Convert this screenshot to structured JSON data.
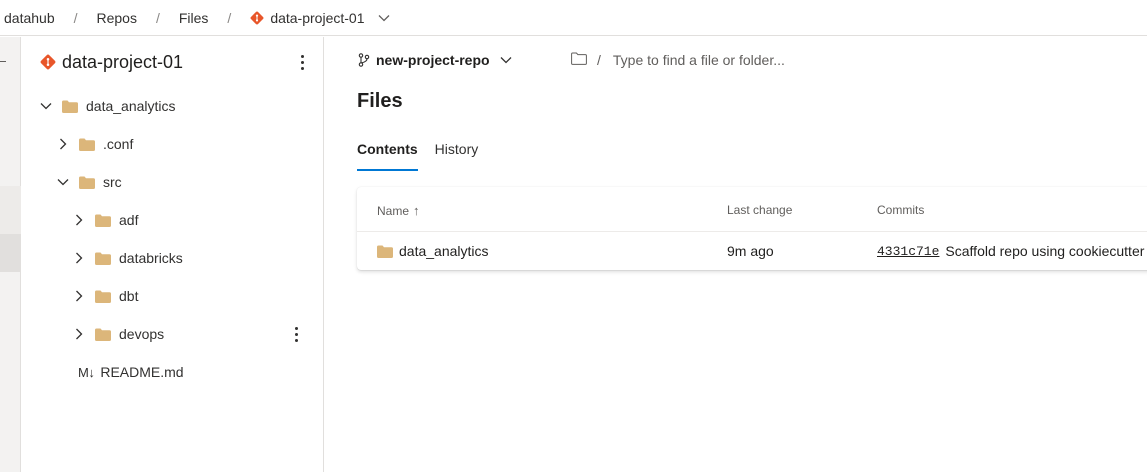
{
  "breadcrumb": {
    "org": "datahub",
    "section": "Repos",
    "page": "Files",
    "repo": "data-project-01",
    "separator": "/"
  },
  "tree": {
    "title": "data-project-01",
    "nodes": [
      {
        "label": "data_analytics",
        "type": "folder",
        "expanded": true
      },
      {
        "label": ".conf",
        "type": "folder",
        "expanded": false
      },
      {
        "label": "src",
        "type": "folder",
        "expanded": true
      },
      {
        "label": "adf",
        "type": "folder",
        "expanded": false
      },
      {
        "label": "databricks",
        "type": "folder",
        "expanded": false
      },
      {
        "label": "dbt",
        "type": "folder",
        "expanded": false
      },
      {
        "label": "devops",
        "type": "folder",
        "expanded": false
      },
      {
        "label": "README.md",
        "type": "markdown"
      }
    ],
    "md_glyph": "M↓"
  },
  "main": {
    "branch": "new-project-repo",
    "path_separator": "/",
    "path_placeholder": "Type to find a file or folder...",
    "title": "Files",
    "tabs": [
      {
        "label": "Contents",
        "active": true
      },
      {
        "label": "History",
        "active": false
      }
    ],
    "table": {
      "columns": {
        "name": "Name",
        "last_change": "Last change",
        "commits": "Commits"
      },
      "sort_indicator": "↑",
      "rows": [
        {
          "name": "data_analytics",
          "last_change": "9m ago",
          "commit_id": "4331c71e",
          "commit_msg": "Scaffold repo using cookiecutter"
        }
      ]
    }
  },
  "colors": {
    "accent": "#0078d4",
    "folder": "#dcb67a",
    "git": "#e8562a"
  }
}
